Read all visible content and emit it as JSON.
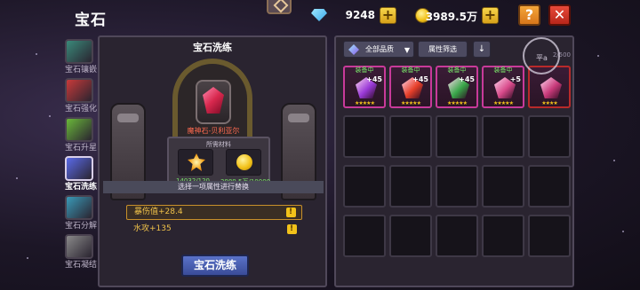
{
  "header": {
    "title": "宝石",
    "diamonds": "9248",
    "gold": "3989.5万",
    "help_label": "?",
    "close_label": "✕",
    "plus_label": "+"
  },
  "tabs": [
    {
      "label": "宝石镶嵌",
      "icon": "gem-socket-icon",
      "color": "#3a8a7a"
    },
    {
      "label": "宝石强化",
      "icon": "gem-upgrade-icon",
      "color": "#c83a3a"
    },
    {
      "label": "宝石升星",
      "icon": "gem-star-icon",
      "color": "#6ab83a"
    },
    {
      "label": "宝石洗练",
      "icon": "gem-refine-icon",
      "color": "#5a6ae8",
      "active": true
    },
    {
      "label": "宝石分解",
      "icon": "gem-decompose-icon",
      "color": "#3a9ab8"
    },
    {
      "label": "宝石凝结",
      "icon": "gem-condense-icon",
      "color": "#8a8a8a"
    }
  ],
  "refine_panel": {
    "title": "宝石洗练",
    "gem_name": "魔神石-贝利亚尔",
    "materials_title": "所需材料",
    "material_gem_count": "14032/120",
    "material_gold_count": "3989.5万/10000",
    "select_prompt": "选择一项属性进行替换",
    "attributes": [
      {
        "text": "暴伤值+28.4",
        "selected": true
      },
      {
        "text": "水攻+135",
        "selected": false
      }
    ],
    "refine_button": "宝石洗练"
  },
  "inventory": {
    "filter_quality": "全部品质",
    "filter_attr": "属性筛选",
    "sort_icon": "↓",
    "count": "2/500",
    "ring_label": "平a",
    "items": [
      {
        "equipped": true,
        "equip_tag": "装备中",
        "plus": "+45",
        "gem_color": "#9a3ad8",
        "style": "pink",
        "stars": "★★★★★"
      },
      {
        "equipped": true,
        "equip_tag": "装备中",
        "plus": "+45",
        "gem_color": "#e8402a",
        "style": "pink",
        "stars": "★★★★★"
      },
      {
        "equipped": true,
        "equip_tag": "装备中",
        "plus": "+45",
        "gem_color": "#3aa84a",
        "style": "pink",
        "stars": "★★★★★"
      },
      {
        "equipped": true,
        "equip_tag": "装备中",
        "plus": "+5",
        "gem_color": "#d84a8a",
        "style": "pink",
        "stars": "★★★★★"
      },
      {
        "equipped": false,
        "equip_tag": "",
        "plus": "",
        "gem_color": "#c83a7a",
        "style": "plain",
        "stars": "★★★★"
      }
    ]
  }
}
